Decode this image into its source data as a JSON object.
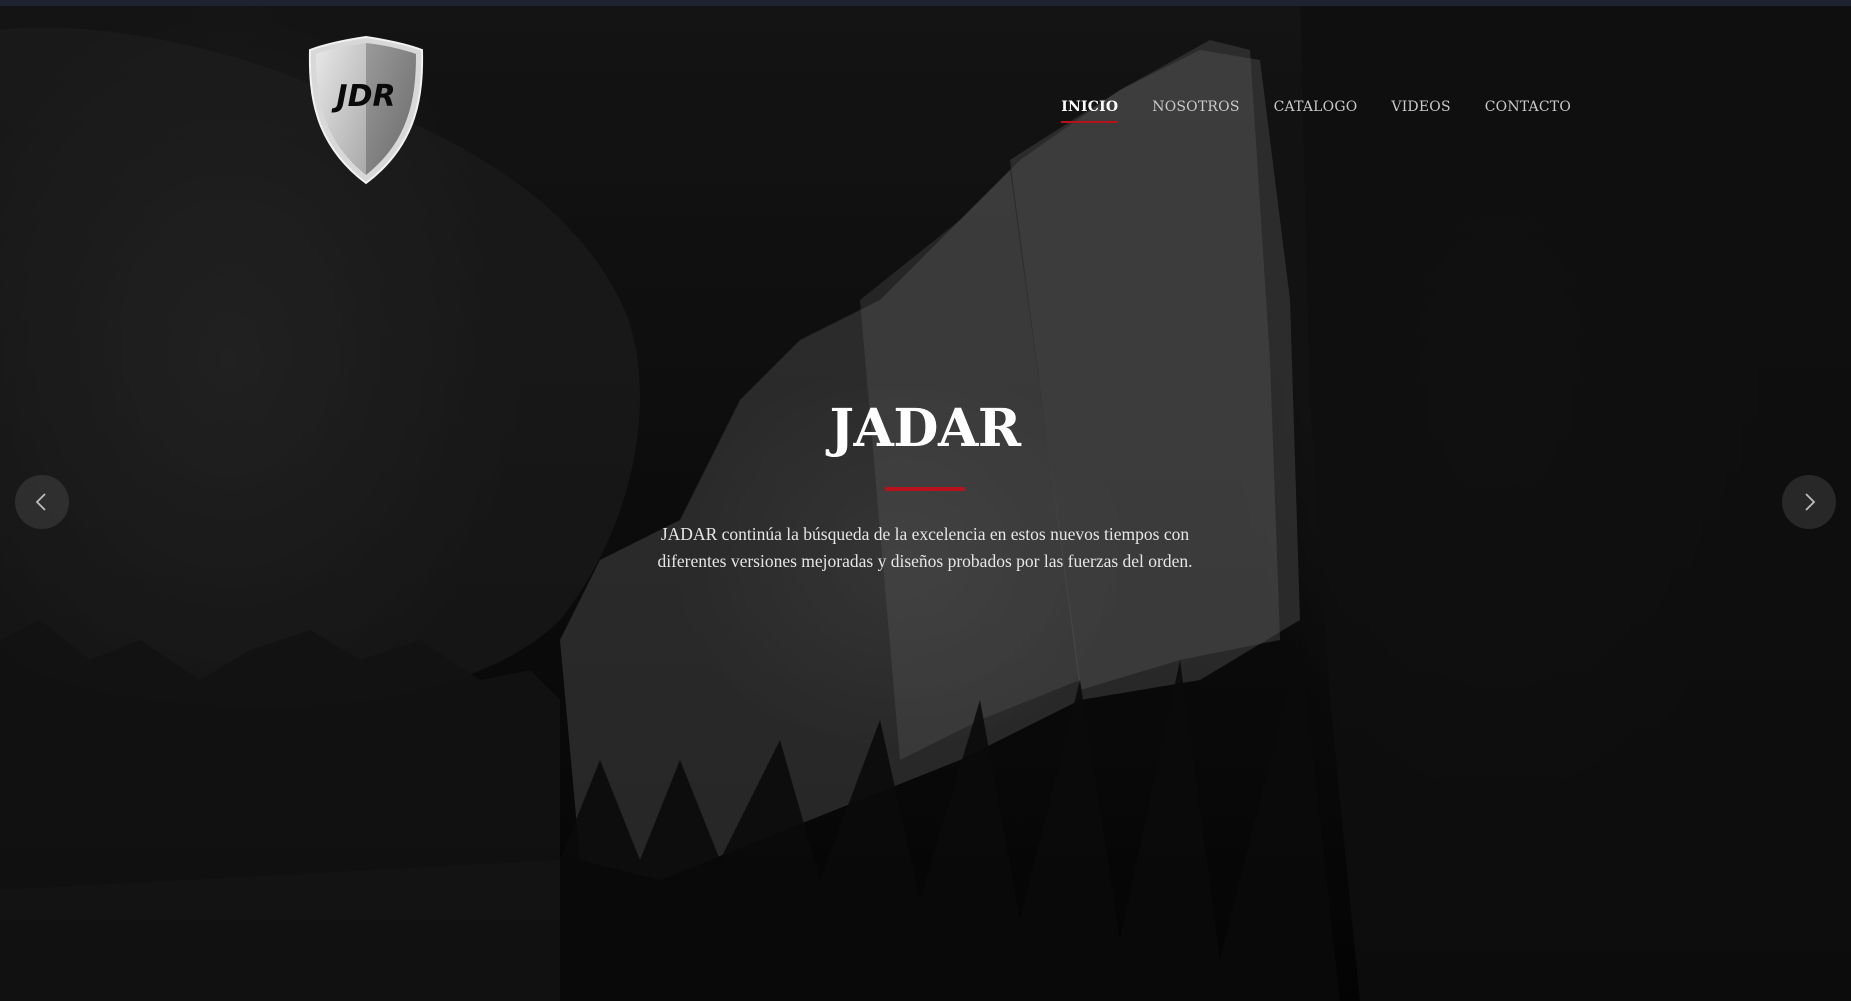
{
  "brand": {
    "logo_text": "JDR",
    "logo_icon": "shield-logo"
  },
  "nav": {
    "items": [
      {
        "label": "INICIO",
        "active": true
      },
      {
        "label": "NOSOTROS",
        "active": false
      },
      {
        "label": "CATALOGO",
        "active": false
      },
      {
        "label": "VIDEOS",
        "active": false
      },
      {
        "label": "CONTACTO",
        "active": false
      }
    ]
  },
  "hero": {
    "title": "JADAR",
    "text_line1": "JADAR continúa la búsqueda de la excelencia en estos nuevos tiempos con",
    "text_line2": "diferentes versiones mejoradas y diseños probados por las fuerzas del orden."
  },
  "slider": {
    "prev_icon": "chevron-left-icon",
    "next_icon": "chevron-right-icon"
  },
  "colors": {
    "accent": "#b5121b",
    "text": "#ffffff",
    "nav_text": "#c9c9c9"
  }
}
